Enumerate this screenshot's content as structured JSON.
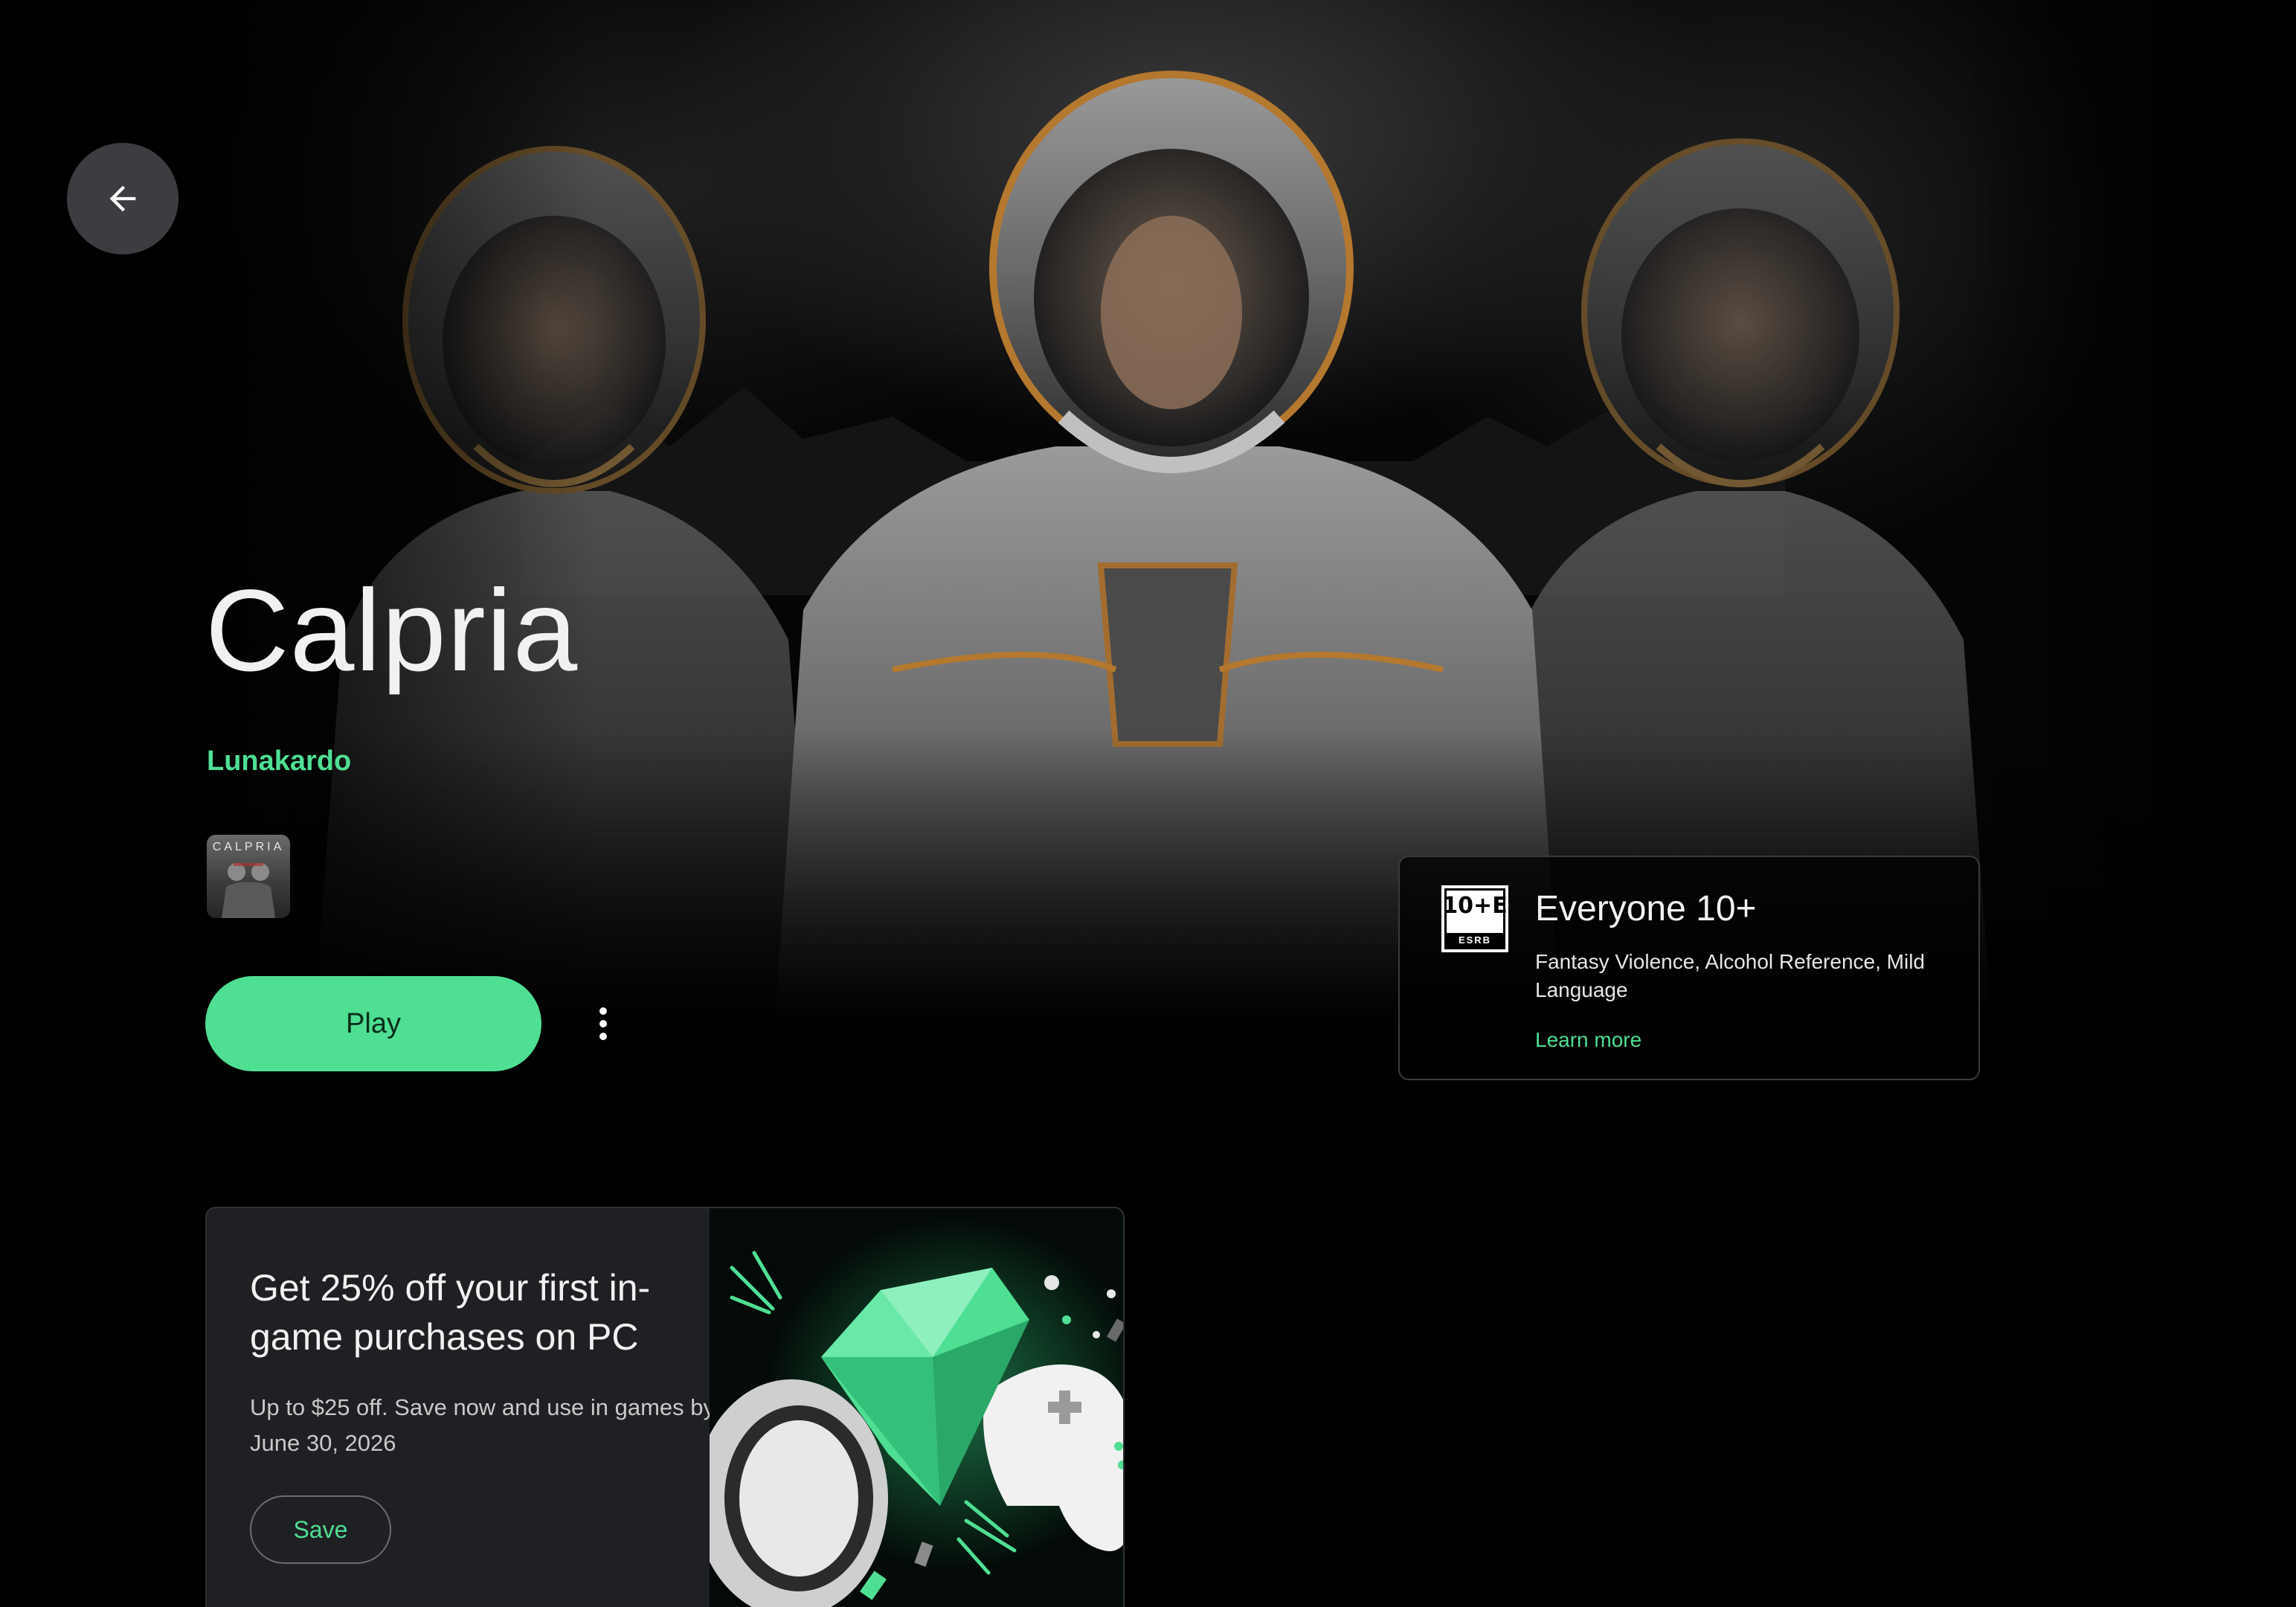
{
  "header": {
    "back_button_label": "Back"
  },
  "game": {
    "title": "Calpria",
    "developer": "Lunakardo",
    "icon_text": "CALPRIA",
    "play_label": "Play"
  },
  "rating": {
    "esrb_top": "10+E",
    "esrb_bottom": "ESRB",
    "title": "Everyone 10+",
    "descriptors": "Fantasy Violence, Alcohol Reference, Mild Language",
    "learn_more": "Learn more"
  },
  "promo": {
    "title": "Get 25% off your first in-game purchases on PC",
    "subtitle": "Up to $25 off. Save now and use in games by June 30, 2026",
    "save_label": "Save"
  },
  "colors": {
    "accent": "#4fdf93",
    "background": "#000000",
    "card": "#1f2023"
  },
  "icons": [
    "arrow-left-icon",
    "more-vert-icon",
    "esrb-rating-icon",
    "diamond-icon",
    "gamepad-icon"
  ]
}
